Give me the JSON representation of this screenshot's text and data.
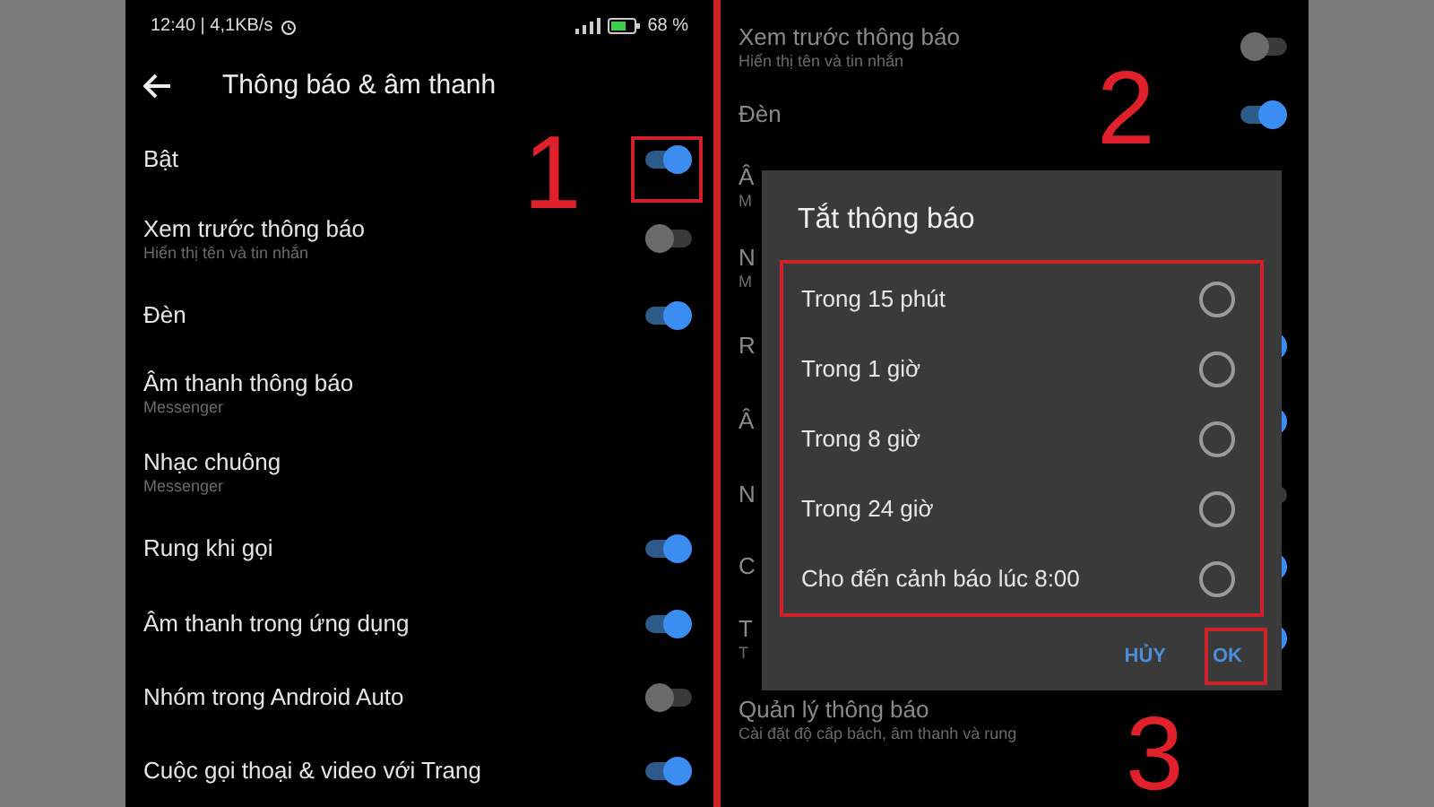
{
  "left_phone": {
    "status_bar": {
      "time": "12:40 | 4,1KB/s",
      "battery": "68 %"
    },
    "header": {
      "title": "Thông báo & âm thanh"
    },
    "settings": [
      {
        "label": "Bật",
        "kind": "toggle",
        "on": true
      },
      {
        "label": "Xem trước thông báo",
        "subtitle": "Hiển thị tên và tin nhắn",
        "kind": "toggle",
        "on": false
      },
      {
        "label": "Đèn",
        "kind": "toggle",
        "on": true
      },
      {
        "label": "Âm thanh thông báo",
        "subtitle": "Messenger",
        "kind": "text"
      },
      {
        "label": "Nhạc chuông",
        "subtitle": "Messenger",
        "kind": "text"
      },
      {
        "label": "Rung khi gọi",
        "kind": "toggle",
        "on": true
      },
      {
        "label": "Âm thanh trong ứng dụng",
        "kind": "toggle",
        "on": true
      },
      {
        "label": "Nhóm trong Android Auto",
        "kind": "toggle",
        "on": false
      },
      {
        "label": "Cuộc gọi thoại & video với Trang",
        "kind": "toggle",
        "on": true
      }
    ]
  },
  "right_phone": {
    "settings": [
      {
        "label": "Xem trước thông báo",
        "subtitle": "Hiển thị tên và tin nhắn",
        "kind": "toggle",
        "on": false
      },
      {
        "label": "Đèn",
        "kind": "toggle",
        "on": true
      },
      {
        "label": "Â",
        "subtitle": "M",
        "kind": "text"
      },
      {
        "label": "N",
        "subtitle": "M",
        "kind": "text"
      },
      {
        "label": "R",
        "kind": "toggle",
        "on": true
      },
      {
        "label": "Â",
        "kind": "toggle",
        "on": true
      },
      {
        "label": "N",
        "kind": "toggle",
        "on": false
      },
      {
        "label": "C",
        "kind": "toggle",
        "on": true
      },
      {
        "label": "T",
        "subtitle": "T",
        "kind": "toggle",
        "on": true
      },
      {
        "label": "Quản lý thông báo",
        "subtitle": "Cài đặt độ cấp bách, âm thanh và rung",
        "kind": "text"
      }
    ],
    "dialog": {
      "title": "Tắt thông báo",
      "options": [
        {
          "label": "Trong 15 phút",
          "selected": false
        },
        {
          "label": "Trong 1 giờ",
          "selected": false
        },
        {
          "label": "Trong 8 giờ",
          "selected": false
        },
        {
          "label": "Trong 24 giờ",
          "selected": false
        },
        {
          "label": "Cho đến cảnh báo lúc 8:00",
          "selected": false
        }
      ],
      "buttons": [
        "HỦY",
        "OK"
      ]
    }
  },
  "annotations": [
    "1",
    "2",
    "3"
  ]
}
